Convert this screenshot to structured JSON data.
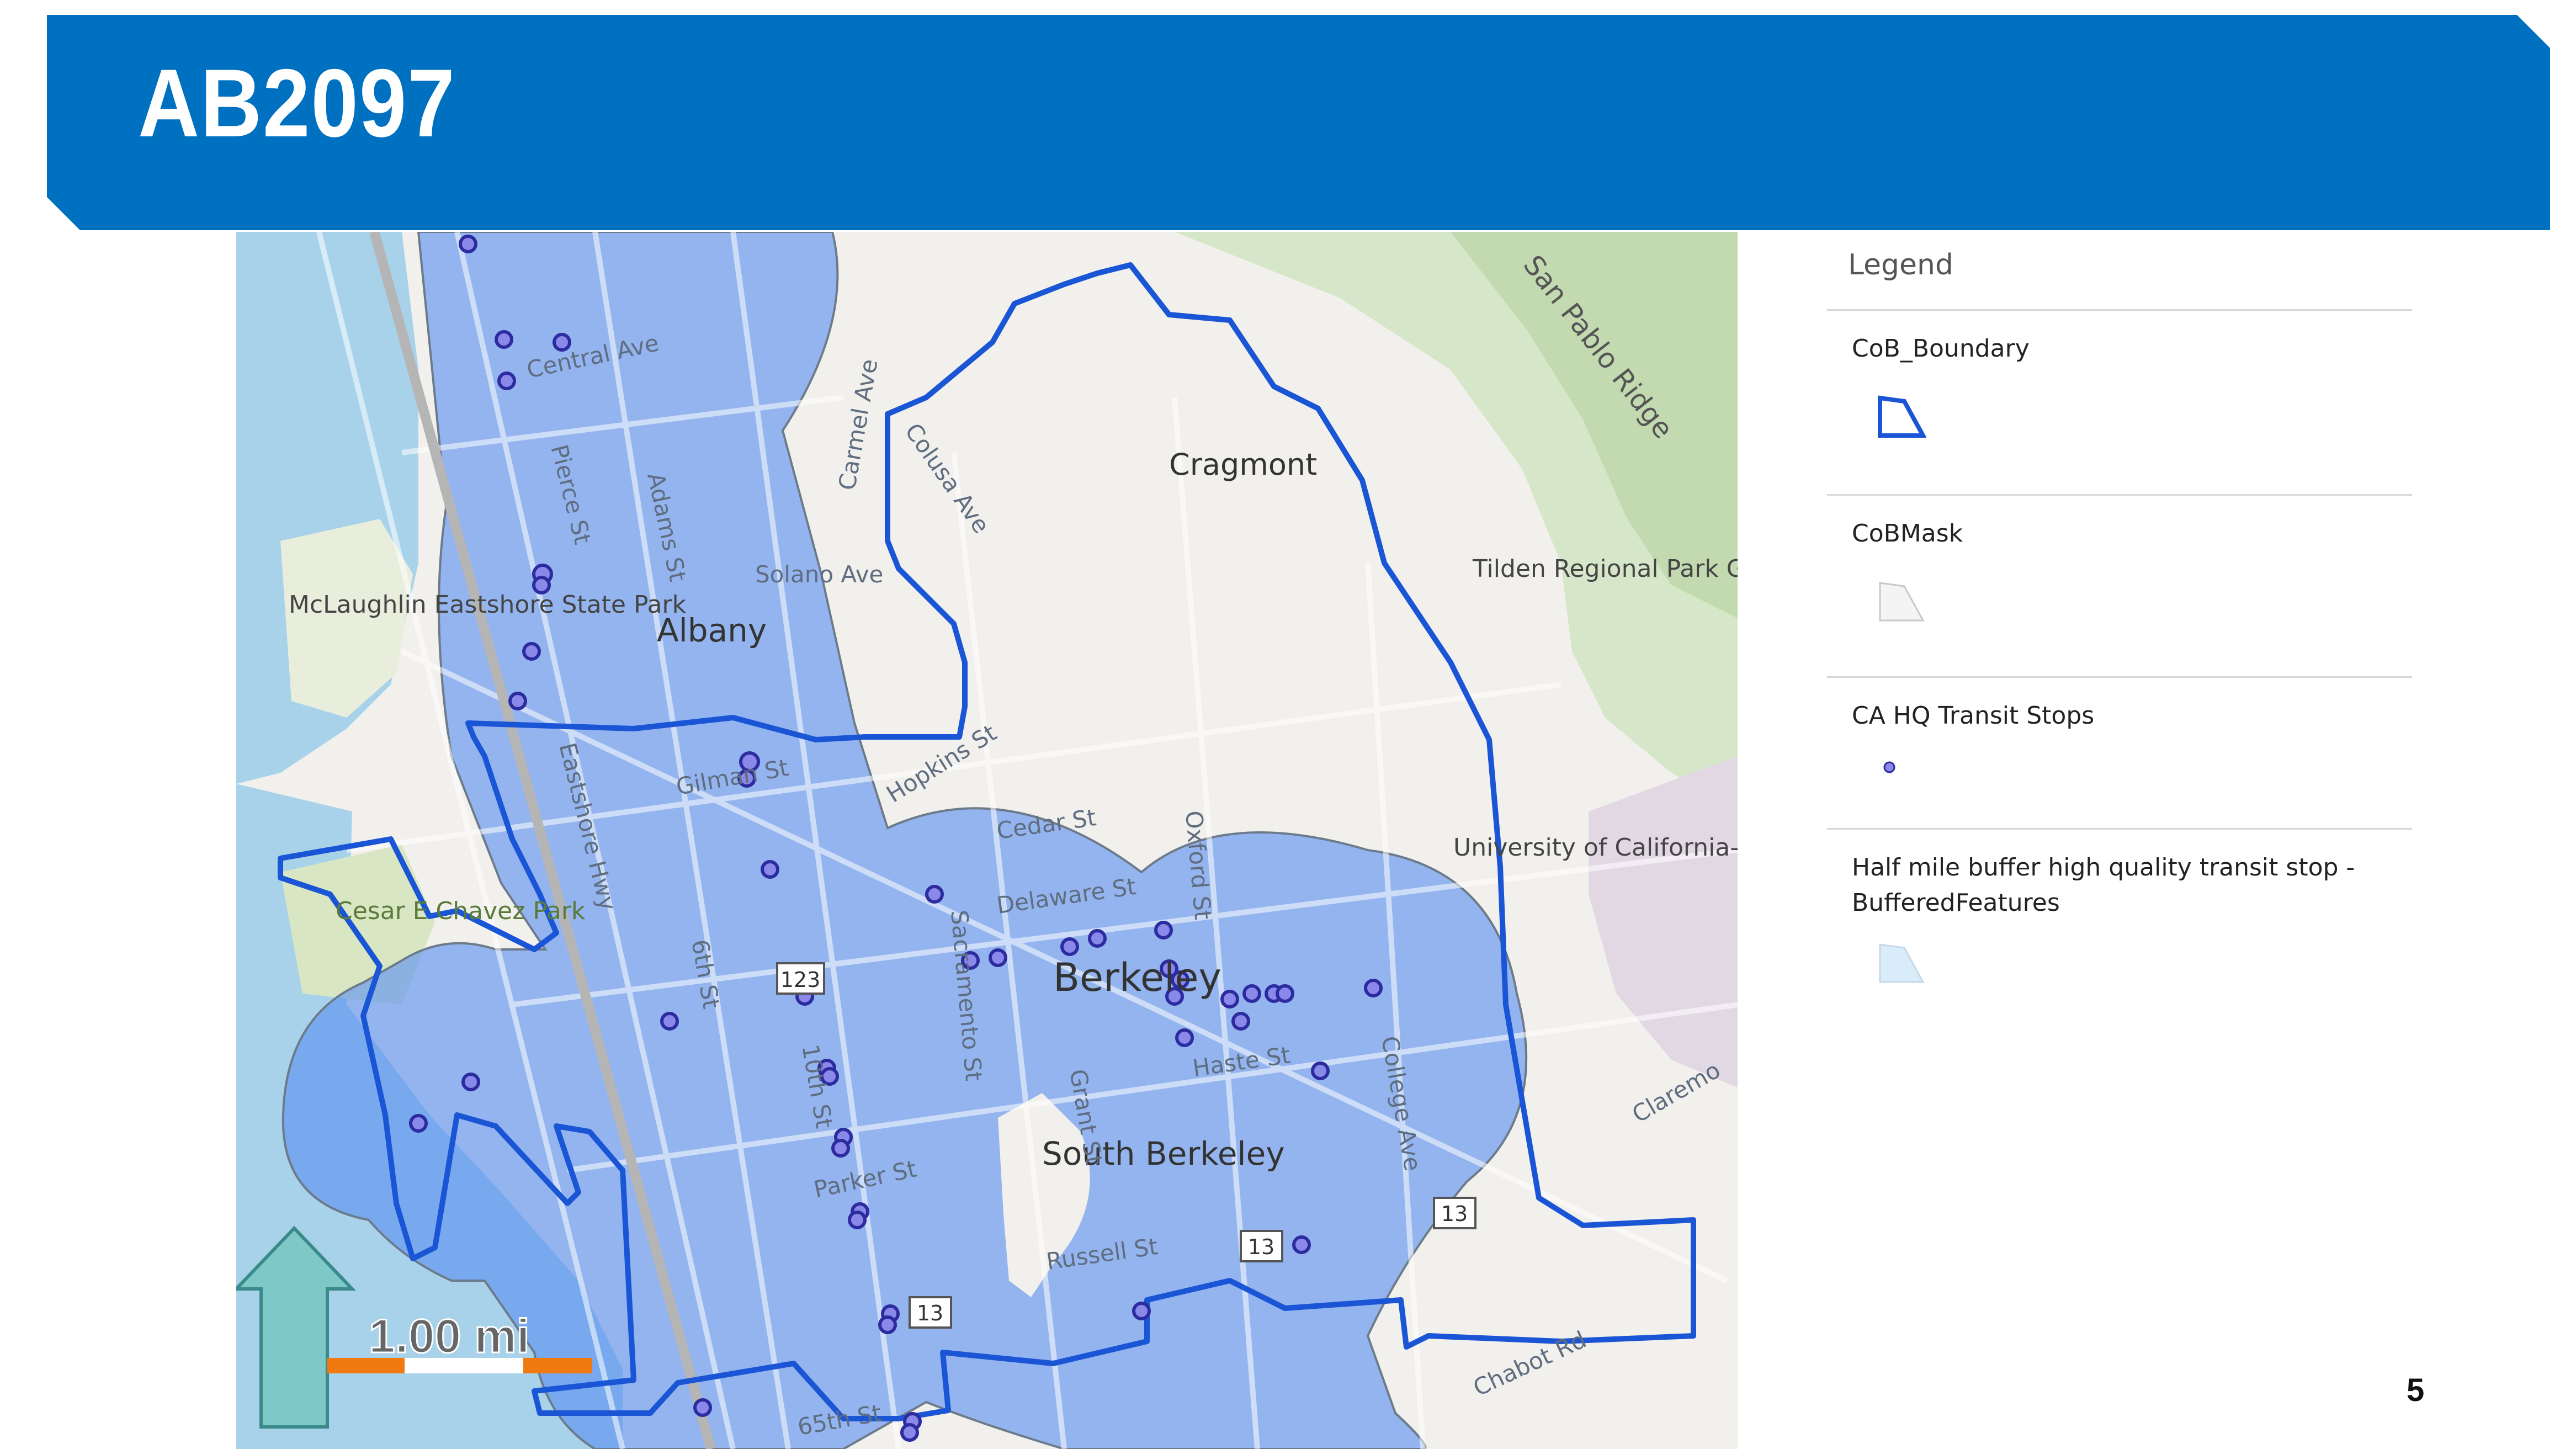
{
  "slide": {
    "title": "AB2097",
    "page_number": "5"
  },
  "colors": {
    "header_blue": "#0070c0",
    "water": "#a8d2ea",
    "buffer": "#5b8ff0",
    "boundary": "#1a55d6",
    "stop_fill": "#8a88e8",
    "stop_stroke": "#2c2ca0",
    "north_arrow": "#7ec8c8",
    "scale_bar": "#f07a10"
  },
  "map": {
    "labels": {
      "albany": "Albany",
      "berkeley": "Berkeley",
      "south_berkeley": "South Berkeley",
      "cragmont": "Cragmont",
      "mclaughlin": "McLaughlin Eastshore State Park",
      "cesar_chavez": "Cesar E Chavez Park",
      "tilden": "Tilden Regional Park Golf Course",
      "uc_berkeley": "University of California-Berkeley",
      "san_pablo_ridge": "San Pablo Ridge",
      "central_ave": "Central Ave",
      "solano_ave": "Solano Ave",
      "gilman_st": "Gilman St",
      "hopkins_st": "Hopkins St",
      "cedar_st": "Cedar St",
      "delaware_st": "Delaware St",
      "haste_st": "Haste St",
      "parker_st": "Parker St",
      "russell_st": "Russell St",
      "65th_st": "65th St",
      "chabot_rd": "Chabot Rd",
      "colusa_ave": "Colusa Ave",
      "carmel_ave": "Carmel Ave",
      "oxford_st": "Oxford St",
      "sacramento_st": "Sacramento St",
      "6th_st": "6th St",
      "10th_st": "10th St",
      "college_ave": "College Ave",
      "grant_st": "Grant St",
      "eastshore_hwy": "Eastshore Hwy",
      "adams_st": "Adams St",
      "pierce_st": "Pierce St",
      "claremont": "Claremo",
      "route_13": "13",
      "route_123": "123"
    },
    "scale_label": "1.00 mi",
    "north_arrow": "north-arrow-icon"
  },
  "legend": {
    "title": "Legend",
    "items": [
      {
        "name": "CoB_Boundary",
        "symbol": "polygon-outline-blue"
      },
      {
        "name": "CoBMask",
        "symbol": "polygon-light-gray"
      },
      {
        "name": "CA HQ Transit Stops",
        "symbol": "point-blue"
      },
      {
        "name": "Half mile buffer high quality transit stop - BufferedFeatures",
        "symbol": "polygon-light-blue"
      }
    ]
  }
}
